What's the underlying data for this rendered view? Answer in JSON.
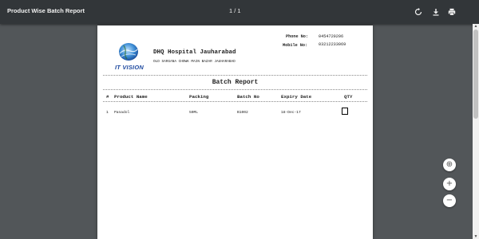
{
  "toolbar": {
    "title": "Product Wise Batch Report",
    "page_indicator": "1 / 1",
    "buttons": [
      {
        "icon": "rotate-icon"
      },
      {
        "icon": "download-icon"
      },
      {
        "icon": "print-icon"
      }
    ]
  },
  "report": {
    "logo_text": "IT VISION",
    "hospital_name": "DHQ Hospital Jauharabad",
    "address": "OLD SARGANA CHOWK MAIN BAZAR JAUHARABAD",
    "phone_label": "Phone No:",
    "phone_value": "0454720206",
    "mobile_label": "Mobile No:",
    "mobile_value": "03212233069",
    "title": "Batch Report",
    "columns": [
      "#",
      "Product Name",
      "Packing",
      "Batch No",
      "Expiry Date",
      "QTY"
    ],
    "rows": [
      [
        "1",
        "Panadol",
        "50ML",
        "B1002",
        "18-Dec-17",
        ""
      ]
    ]
  },
  "zoom_controls": {
    "fit": "⊕",
    "zoom_in": "+",
    "zoom_out": "−"
  },
  "colors": {
    "toolbar": "#323639",
    "viewer_bg": "#525659",
    "logo_blue": "#1f4aa0"
  }
}
